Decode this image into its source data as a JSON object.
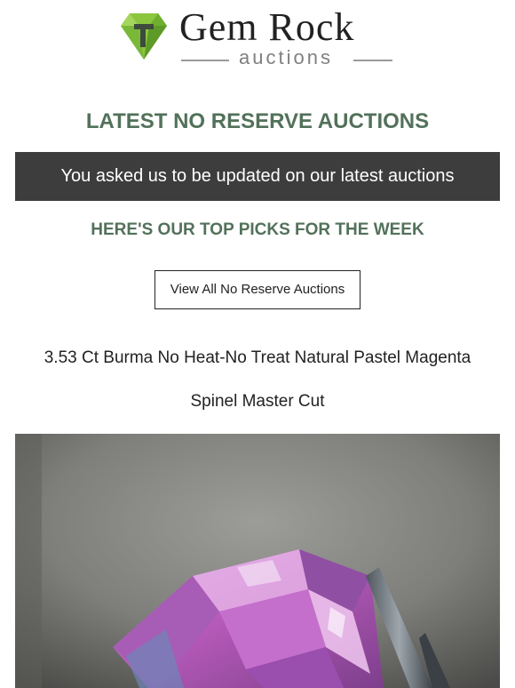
{
  "header": {
    "logo": {
      "title": "Gem Rock",
      "subtitle": "auctions",
      "icon": "gem-icon",
      "accent": "#7cb342"
    }
  },
  "main": {
    "headline": "LATEST NO RESERVE AUCTIONS",
    "banner_text": "You asked us to be updated on our latest auctions",
    "subheading": "HERE'S OUR TOP PICKS FOR THE WEEK",
    "cta_label": "View All No Reserve Auctions",
    "product": {
      "title_line1": "3.53 Ct Burma No Heat-No Treat Natural Pastel Magenta",
      "title_line2": "Spinel Master Cut",
      "image": "spinel-gemstone-photo"
    }
  },
  "colors": {
    "heading_green": "#52715a",
    "banner_bg": "#3d3d3d",
    "text": "#222222"
  }
}
